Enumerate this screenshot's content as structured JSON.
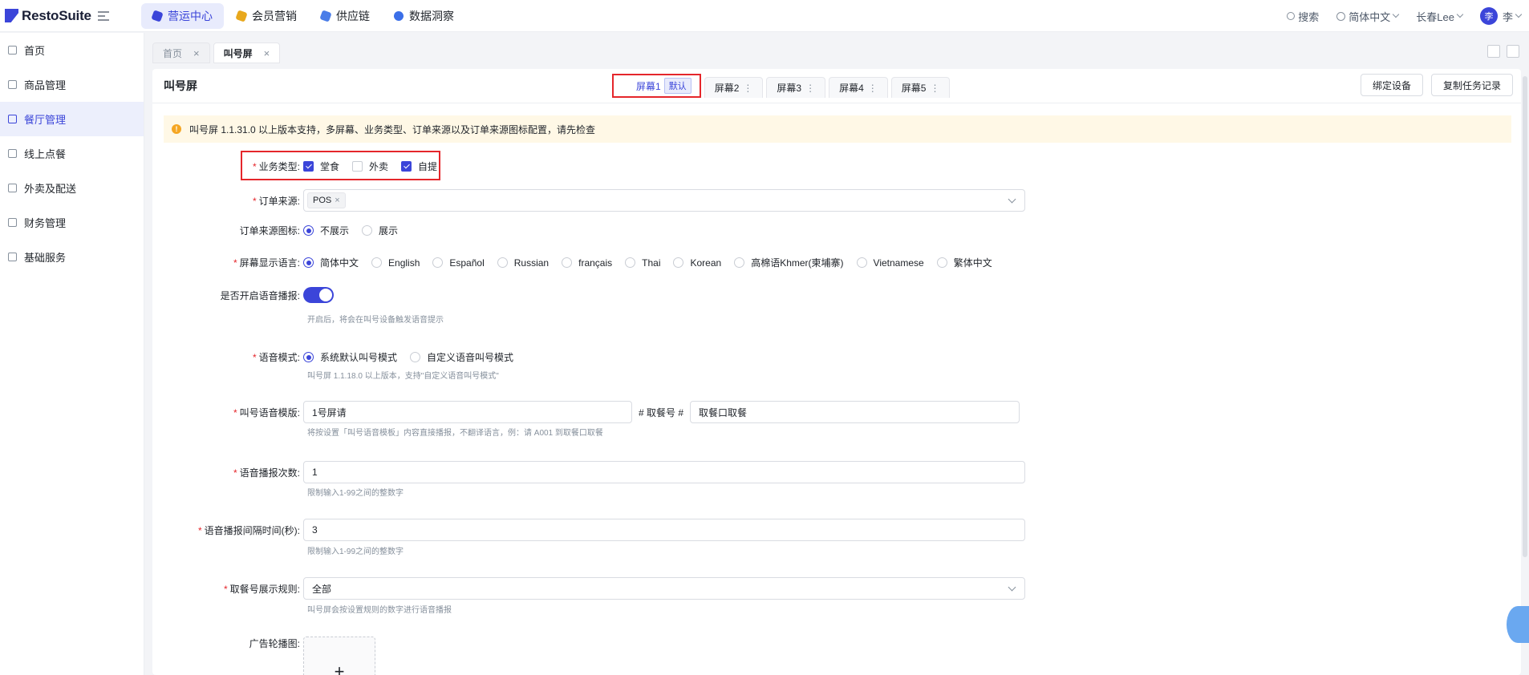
{
  "brand": {
    "name": "RestoSuite",
    "accent": "#3b45d9"
  },
  "topnav": [
    {
      "label": "营运中心",
      "active": true,
      "color": "#3b45d9"
    },
    {
      "label": "会员营销",
      "active": false,
      "color": "#e8a81d"
    },
    {
      "label": "供应链",
      "active": false,
      "color": "#4a7de8"
    },
    {
      "label": "数据洞察",
      "active": false,
      "color": "#3b6fe8"
    }
  ],
  "topright": {
    "search": "搜索",
    "language": "简体中文",
    "user": "长春Lee",
    "avatar_initial": "李",
    "avatar_name": "李"
  },
  "sidebar": [
    {
      "label": "首页",
      "icon": "home-icon"
    },
    {
      "label": "商品管理",
      "icon": "cube-icon"
    },
    {
      "label": "餐厅管理",
      "icon": "store-icon",
      "active": true
    },
    {
      "label": "线上点餐",
      "icon": "hand-icon"
    },
    {
      "label": "外卖及配送",
      "icon": "bag-icon"
    },
    {
      "label": "财务管理",
      "icon": "folder-icon"
    },
    {
      "label": "基础服务",
      "icon": "grid-icon"
    }
  ],
  "pagetabs": [
    {
      "label": "首页",
      "active": false
    },
    {
      "label": "叫号屏",
      "active": true
    }
  ],
  "page": {
    "title": "叫号屏",
    "screens": [
      {
        "label": "屏幕1",
        "badge": "默认",
        "active": true
      },
      {
        "label": "屏幕2"
      },
      {
        "label": "屏幕3"
      },
      {
        "label": "屏幕4"
      },
      {
        "label": "屏幕5"
      }
    ],
    "buttons": {
      "bind": "绑定设备",
      "copy": "复制任务记录"
    },
    "notice": "叫号屏 1.1.31.0 以上版本支持，多屏幕、业务类型、订单来源以及订单来源图标配置，请先检查"
  },
  "form": {
    "business_type": {
      "label": "业务类型",
      "options": [
        {
          "label": "堂食",
          "checked": true
        },
        {
          "label": "外卖",
          "checked": false
        },
        {
          "label": "自提",
          "checked": true
        }
      ]
    },
    "order_source": {
      "label": "订单来源",
      "tags": [
        "POS"
      ]
    },
    "source_icon": {
      "label": "订单来源图标",
      "options": [
        {
          "label": "不展示",
          "checked": true
        },
        {
          "label": "展示",
          "checked": false
        }
      ]
    },
    "language": {
      "label": "屏幕显示语言",
      "options": [
        {
          "label": "简体中文",
          "checked": true
        },
        {
          "label": "English"
        },
        {
          "label": "Español"
        },
        {
          "label": "Russian"
        },
        {
          "label": "français"
        },
        {
          "label": "Thai"
        },
        {
          "label": "Korean"
        },
        {
          "label": "高棉语Khmer(柬埔寨)"
        },
        {
          "label": "Vietnamese"
        },
        {
          "label": "繁体中文"
        }
      ]
    },
    "voice_enable": {
      "label": "是否开启语音播报",
      "on": true,
      "hint": "开启后，将会在叫号设备触发语音提示"
    },
    "voice_mode": {
      "label": "语音模式",
      "options": [
        {
          "label": "系统默认叫号模式",
          "checked": true
        },
        {
          "label": "自定义语音叫号模式",
          "checked": false
        }
      ],
      "hint": "叫号屏 1.1.18.0 以上版本，支持\"自定义语音叫号模式\""
    },
    "template": {
      "label": "叫号语音模版",
      "value1": "1号屏请",
      "middle": "# 取餐号 #",
      "value2": "取餐口取餐",
      "hint": "将按设置「叫号语音模板」内容直接播报，不翻译语言，例：请 A001 到取餐口取餐"
    },
    "times": {
      "label": "语音播报次数",
      "value": "1",
      "hint": "限制输入1-99之间的整数字"
    },
    "interval": {
      "label": "语音播报间隔时间(秒)",
      "value": "3",
      "hint": "限制输入1-99之间的整数字"
    },
    "rule": {
      "label": "取餐号展示规则",
      "value": "全部",
      "hint": "叫号屏会按设置规则的数字进行语音播报"
    },
    "ads": {
      "label": "广告轮播图",
      "plus": "+"
    }
  }
}
